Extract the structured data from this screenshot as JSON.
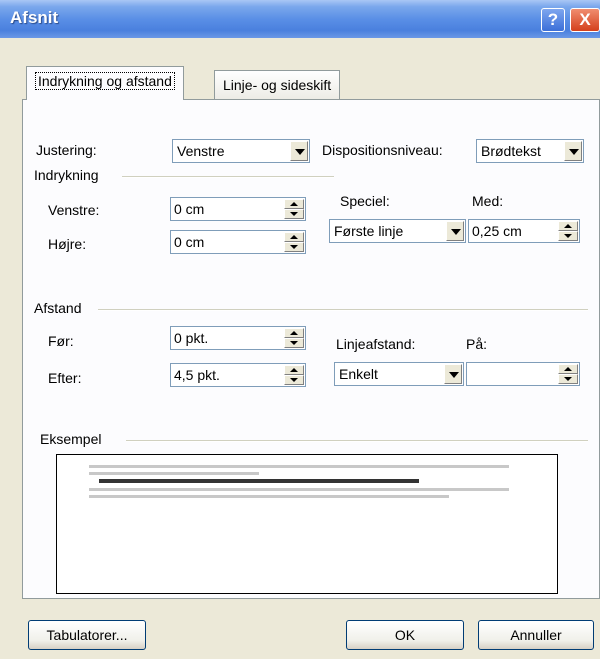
{
  "window": {
    "title": "Afsnit",
    "help_label": "?",
    "close_label": "X"
  },
  "tabs": [
    {
      "label": "Indrykning og afstand",
      "active": true
    },
    {
      "label": "Linje- og sideskift",
      "active": false
    }
  ],
  "alignment": {
    "label": "Justering:",
    "value": "Venstre"
  },
  "outline": {
    "label": "Dispositionsniveau:",
    "value": "Brødtekst"
  },
  "indent": {
    "group_label": "Indrykning",
    "left_label": "Venstre:",
    "left_value": "0 cm",
    "right_label": "Højre:",
    "right_value": "0 cm",
    "special_label": "Speciel:",
    "special_value": "Første linje",
    "by_label": "Med:",
    "by_value": "0,25 cm"
  },
  "spacing": {
    "group_label": "Afstand",
    "before_label": "Før:",
    "before_value": "0 pkt.",
    "after_label": "Efter:",
    "after_value": "4,5 pkt.",
    "line_label": "Linjeafstand:",
    "line_value": "Enkelt",
    "at_label": "På:",
    "at_value": ""
  },
  "preview": {
    "group_label": "Eksempel"
  },
  "buttons": {
    "tabs_label": "Tabulatorer...",
    "ok_label": "OK",
    "cancel_label": "Annuller"
  }
}
